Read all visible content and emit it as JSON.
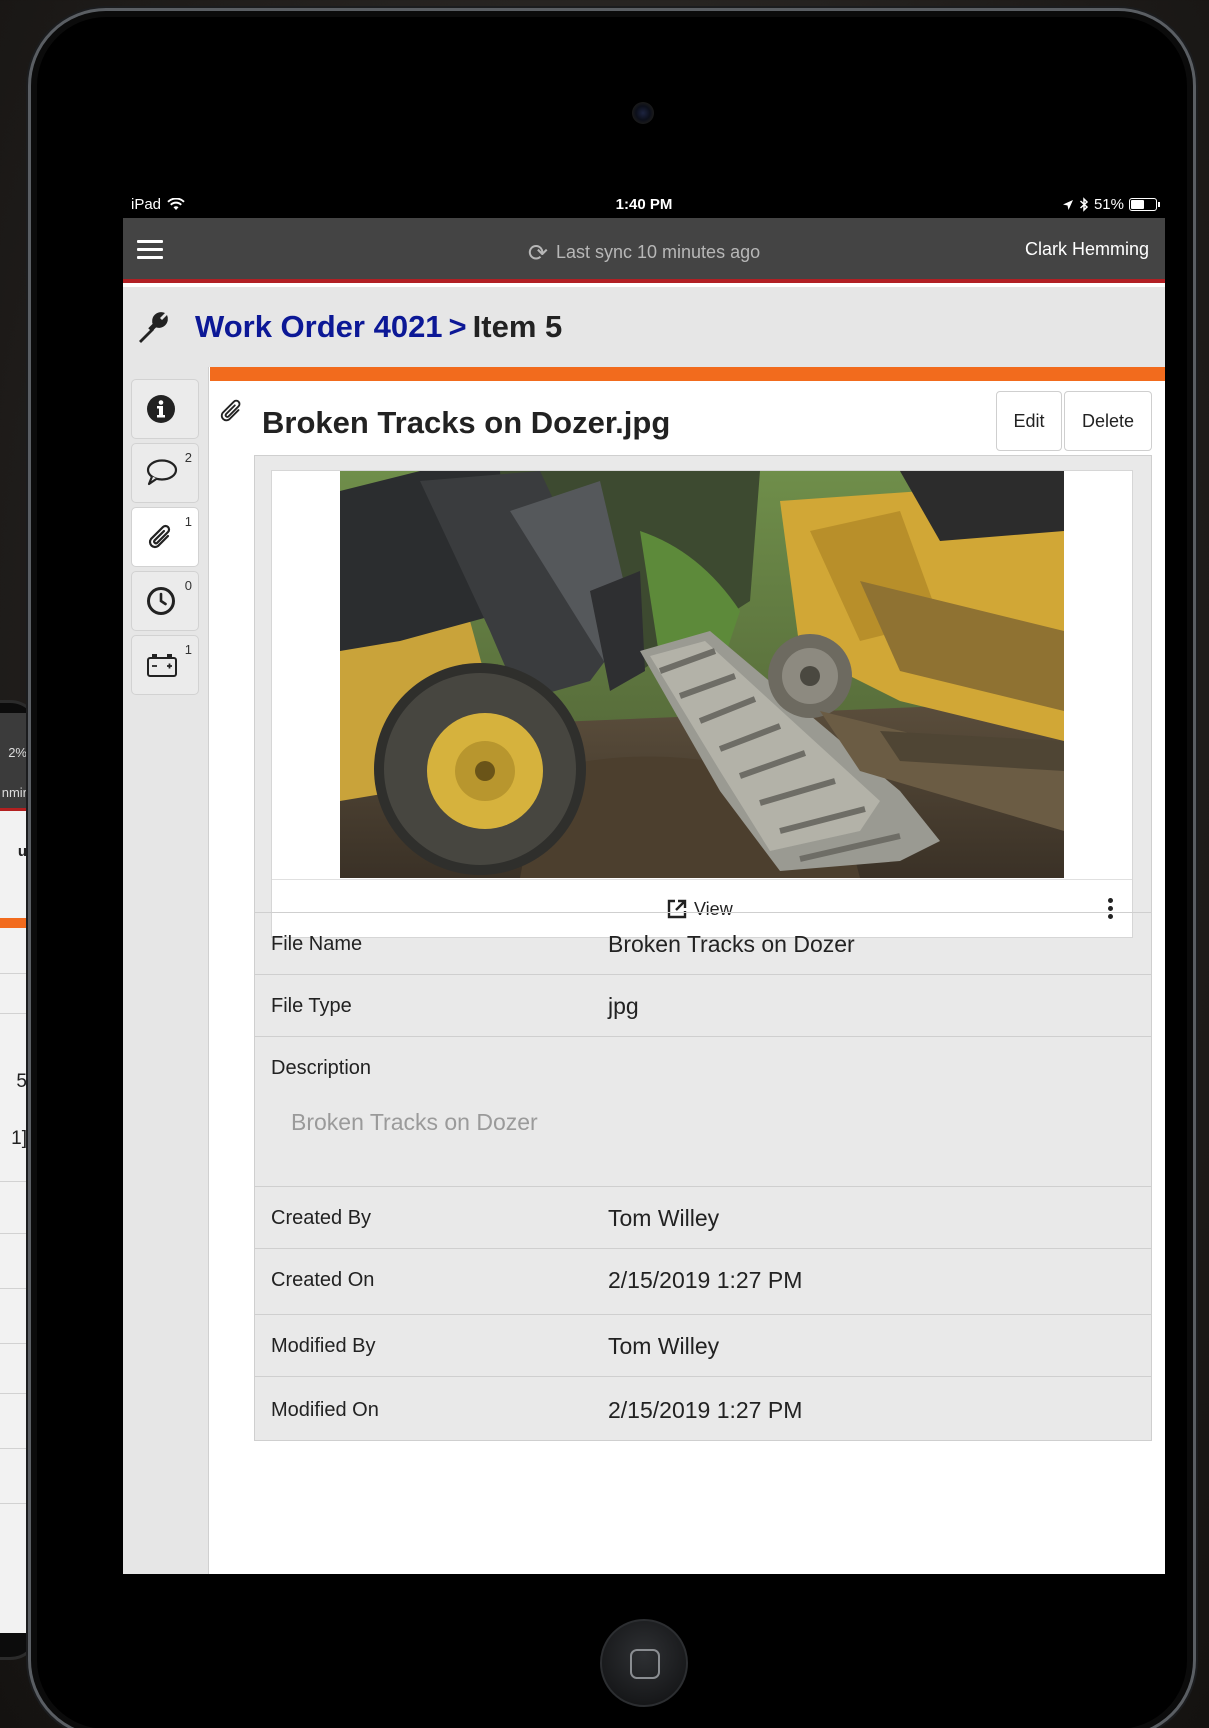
{
  "status_bar": {
    "device": "iPad",
    "time": "1:40 PM",
    "battery": "51%",
    "battery_level": 0.51
  },
  "app_bar": {
    "sync_text": "Last sync 10 minutes ago",
    "user_name": "Clark Hemming"
  },
  "breadcrumb": {
    "parent": "Work Order 4021",
    "separator": ">",
    "current": "Item 5"
  },
  "sidebar": {
    "items": [
      {
        "icon": "info-icon",
        "count": ""
      },
      {
        "icon": "comment-icon",
        "count": "2"
      },
      {
        "icon": "paperclip-icon",
        "count": "1"
      },
      {
        "icon": "clock-icon",
        "count": "0"
      },
      {
        "icon": "battery-icon",
        "count": "1"
      }
    ]
  },
  "attachment": {
    "title": "Broken Tracks on Dozer.jpg",
    "edit_label": "Edit",
    "delete_label": "Delete",
    "view_label": "View",
    "fields": {
      "file_name_label": "File Name",
      "file_name": "Broken Tracks on Dozer",
      "file_type_label": "File Type",
      "file_type": "jpg",
      "description_label": "Description",
      "description": "Broken Tracks on Dozer",
      "created_by_label": "Created By",
      "created_by": "Tom Willey",
      "created_on_label": "Created On",
      "created_on": "2/15/2019 1:27 PM",
      "modified_by_label": "Modified By",
      "modified_by": "Tom Willey",
      "modified_on_label": "Modified On",
      "modified_on": "2/15/2019 1:27 PM"
    }
  },
  "background_device": {
    "battery": "2%",
    "name_fragment": "nmir",
    "dropdown_fragment": "u",
    "value_a": "5",
    "value_b": "1]"
  },
  "colors": {
    "accent_orange": "#f26b1d",
    "app_bar": "#444444",
    "app_bar_border": "#b11f23",
    "link_blue": "#0c1896"
  }
}
